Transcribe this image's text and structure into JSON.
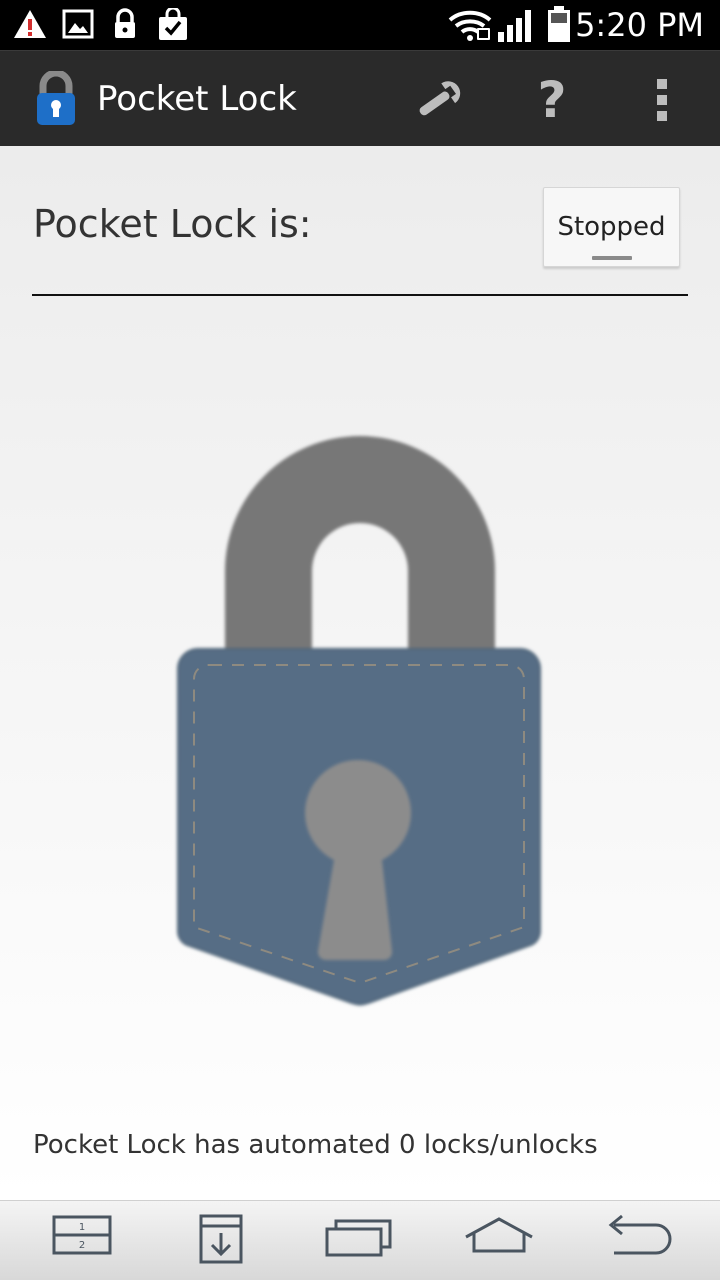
{
  "status_bar": {
    "time": "5:20 PM",
    "icons": [
      "warning-icon",
      "image-icon",
      "lock-icon",
      "bag-check-icon",
      "wifi-icon",
      "signal-icon",
      "battery-icon"
    ]
  },
  "action_bar": {
    "title": "Pocket Lock",
    "actions": [
      "settings-wrench-icon",
      "help-icon",
      "overflow-menu-icon"
    ]
  },
  "main": {
    "status_label": "Pocket Lock is:",
    "status_button_label": "Stopped",
    "counter_text": "Pocket Lock has automated 0 locks/unlocks"
  },
  "nav_bar": {
    "buttons": [
      "dual-window-icon",
      "download-icon",
      "recent-apps-icon",
      "home-icon",
      "back-icon"
    ]
  },
  "colors": {
    "action_bar": "#2a2a2a",
    "lock_shackle": "#777777",
    "lock_pocket": "#566d85",
    "keyhole": "#8c8c8c"
  }
}
